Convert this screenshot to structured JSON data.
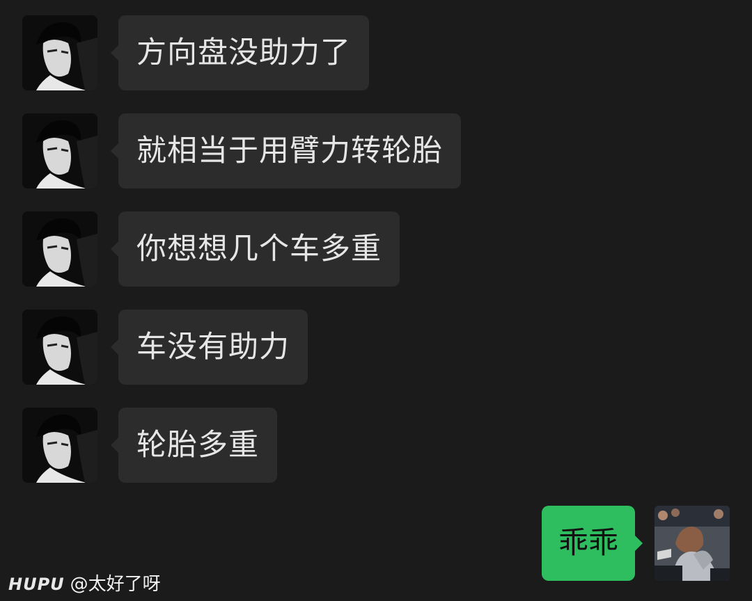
{
  "messages": [
    {
      "sender": "other",
      "text": "方向盘没助力了"
    },
    {
      "sender": "other",
      "text": "就相当于用臂力转轮胎"
    },
    {
      "sender": "other",
      "text": "你想想几个车多重"
    },
    {
      "sender": "other",
      "text": "车没有助力"
    },
    {
      "sender": "other",
      "text": "轮胎多重"
    },
    {
      "sender": "self",
      "text": "乖乖"
    }
  ],
  "avatars": {
    "other": "grayscale-portrait-avatar",
    "self": "courtside-photo-avatar"
  },
  "watermark": {
    "logo": "HUPU",
    "handle": "@太好了呀"
  },
  "colors": {
    "background": "#1b1b1b",
    "incoming_bubble": "#2c2c2c",
    "outgoing_bubble": "#2ebd5f",
    "incoming_text": "#e6e6e6",
    "outgoing_text": "#111111"
  }
}
